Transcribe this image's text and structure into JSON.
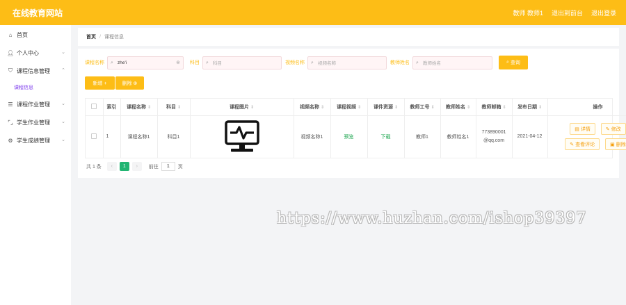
{
  "header": {
    "brand": "在线教育网站",
    "user": "教师 教师1",
    "backend": "退出到前台",
    "logout": "退出登录",
    "color": "#fdbd16"
  },
  "sidebar": {
    "items": [
      {
        "icon": "home-icon",
        "label": "首页"
      },
      {
        "icon": "user-icon",
        "label": "个人中心"
      },
      {
        "icon": "shield-icon",
        "label": "课程信息管理"
      },
      {
        "icon": "list-icon",
        "label": "课程作业管理"
      },
      {
        "icon": "bracket-icon",
        "label": "学生作业管理"
      },
      {
        "icon": "gear-icon",
        "label": "学生成绩管理"
      }
    ],
    "sub_item": "课程信息"
  },
  "breadcrumb": {
    "home": "首页",
    "current": "课程信息"
  },
  "search": {
    "course_label": "课程名称",
    "course_value": "zhe'i",
    "subject_label": "科目",
    "subject_placeholder": "科目",
    "video_label": "视频名称",
    "video_placeholder": "视频名称",
    "teacher_label": "教师姓名",
    "teacher_placeholder": "教师姓名",
    "button": "查询"
  },
  "actions": {
    "add": "新增 +",
    "delete": "删除 ⊕"
  },
  "table": {
    "headers": [
      "索引",
      "课程名称",
      "科目",
      "课程图片",
      "视频名称",
      "课程视频",
      "课件资源",
      "教师工号",
      "教师姓名",
      "教师邮箱",
      "发布日期",
      "操作"
    ],
    "rows": [
      {
        "index": "1",
        "course": "课程名称1",
        "subject": "科目1",
        "video_name": "视频名称1",
        "video": "预览",
        "resource": "下载",
        "teacher_id": "教师1",
        "teacher_name": "教师姓名1",
        "email_line1": "773890001",
        "email_line2": "@qq.com",
        "date": "2021-04-12",
        "ops": {
          "detail": "详情",
          "edit": "修改",
          "comments": "查看评论",
          "delete": "删除"
        }
      }
    ]
  },
  "pager": {
    "total": "共 1 条",
    "prev": "‹",
    "page": "1",
    "next": "›",
    "goto_label": "前往",
    "goto_value": "1",
    "goto_unit": "页"
  },
  "watermark": "https://www.huzhan.com/ishop39397"
}
